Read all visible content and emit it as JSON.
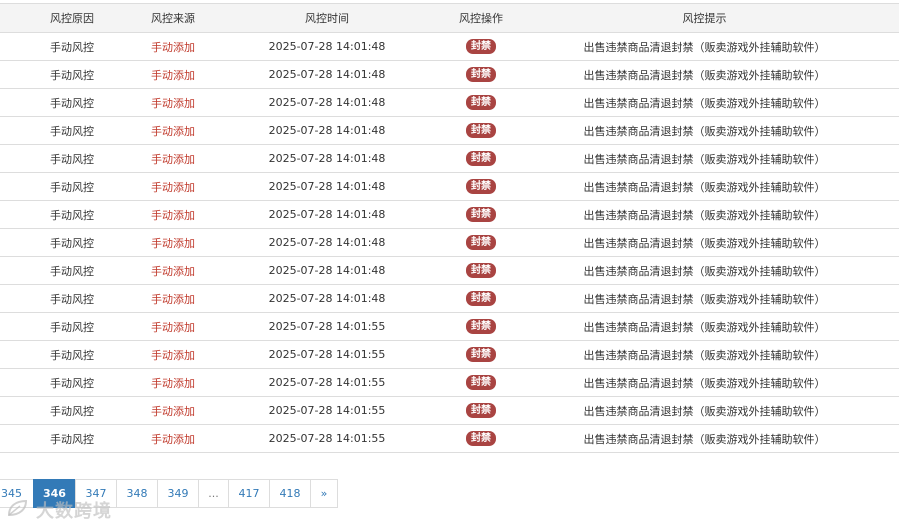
{
  "table": {
    "headers": [
      "风控原因",
      "风控来源",
      "风控时间",
      "风控操作",
      "风控提示"
    ],
    "rows": [
      {
        "reason": "手动风控",
        "source": "手动添加",
        "time": "2025-07-28 14:01:48",
        "action": "封禁",
        "tip": "出售违禁商品清退封禁（贩卖游戏外挂辅助软件）"
      },
      {
        "reason": "手动风控",
        "source": "手动添加",
        "time": "2025-07-28 14:01:48",
        "action": "封禁",
        "tip": "出售违禁商品清退封禁（贩卖游戏外挂辅助软件）"
      },
      {
        "reason": "手动风控",
        "source": "手动添加",
        "time": "2025-07-28 14:01:48",
        "action": "封禁",
        "tip": "出售违禁商品清退封禁（贩卖游戏外挂辅助软件）"
      },
      {
        "reason": "手动风控",
        "source": "手动添加",
        "time": "2025-07-28 14:01:48",
        "action": "封禁",
        "tip": "出售违禁商品清退封禁（贩卖游戏外挂辅助软件）"
      },
      {
        "reason": "手动风控",
        "source": "手动添加",
        "time": "2025-07-28 14:01:48",
        "action": "封禁",
        "tip": "出售违禁商品清退封禁（贩卖游戏外挂辅助软件）"
      },
      {
        "reason": "手动风控",
        "source": "手动添加",
        "time": "2025-07-28 14:01:48",
        "action": "封禁",
        "tip": "出售违禁商品清退封禁（贩卖游戏外挂辅助软件）"
      },
      {
        "reason": "手动风控",
        "source": "手动添加",
        "time": "2025-07-28 14:01:48",
        "action": "封禁",
        "tip": "出售违禁商品清退封禁（贩卖游戏外挂辅助软件）"
      },
      {
        "reason": "手动风控",
        "source": "手动添加",
        "time": "2025-07-28 14:01:48",
        "action": "封禁",
        "tip": "出售违禁商品清退封禁（贩卖游戏外挂辅助软件）"
      },
      {
        "reason": "手动风控",
        "source": "手动添加",
        "time": "2025-07-28 14:01:48",
        "action": "封禁",
        "tip": "出售违禁商品清退封禁（贩卖游戏外挂辅助软件）"
      },
      {
        "reason": "手动风控",
        "source": "手动添加",
        "time": "2025-07-28 14:01:48",
        "action": "封禁",
        "tip": "出售违禁商品清退封禁（贩卖游戏外挂辅助软件）"
      },
      {
        "reason": "手动风控",
        "source": "手动添加",
        "time": "2025-07-28 14:01:55",
        "action": "封禁",
        "tip": "出售违禁商品清退封禁（贩卖游戏外挂辅助软件）"
      },
      {
        "reason": "手动风控",
        "source": "手动添加",
        "time": "2025-07-28 14:01:55",
        "action": "封禁",
        "tip": "出售违禁商品清退封禁（贩卖游戏外挂辅助软件）"
      },
      {
        "reason": "手动风控",
        "source": "手动添加",
        "time": "2025-07-28 14:01:55",
        "action": "封禁",
        "tip": "出售违禁商品清退封禁（贩卖游戏外挂辅助软件）"
      },
      {
        "reason": "手动风控",
        "source": "手动添加",
        "time": "2025-07-28 14:01:55",
        "action": "封禁",
        "tip": "出售违禁商品清退封禁（贩卖游戏外挂辅助软件）"
      },
      {
        "reason": "手动风控",
        "source": "手动添加",
        "time": "2025-07-28 14:01:55",
        "action": "封禁",
        "tip": "出售违禁商品清退封禁（贩卖游戏外挂辅助软件）"
      }
    ]
  },
  "pagination": {
    "pages": [
      "345",
      "346",
      "347",
      "348",
      "349",
      "...",
      "417",
      "418",
      "»"
    ],
    "current": "346"
  },
  "watermark": {
    "text": "大数跨境",
    "icon": "leaf-logo-icon"
  },
  "colors": {
    "source_text": "#c0392b",
    "badge_bg": "#a94442",
    "active_page": "#337ab7"
  }
}
